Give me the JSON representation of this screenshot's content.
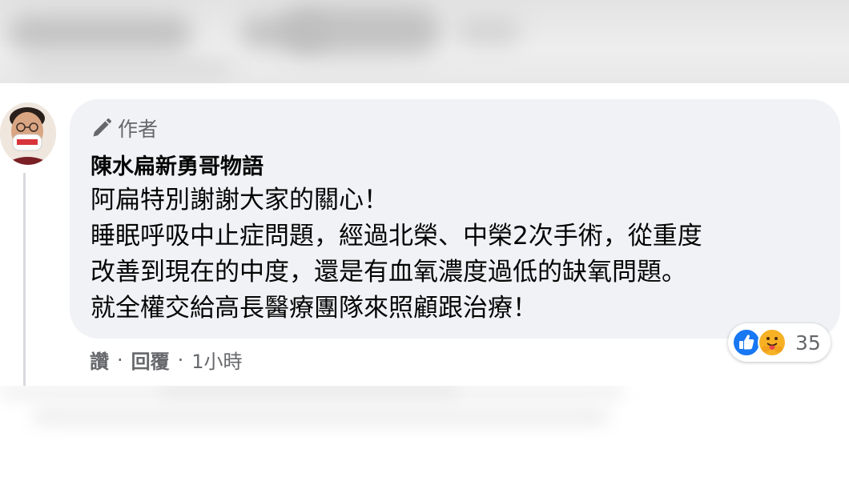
{
  "comment": {
    "author_badge": "作者",
    "author_name": "陳水扁新勇哥物語",
    "lines": [
      "阿扁特別謝謝大家的關心！",
      "睡眠呼吸中止症問題，經過北榮、中榮2次手術，從重度",
      "改善到現在的中度，還是有血氧濃度過低的缺氧問題。",
      "就全權交給高長醫療團隊來照顧跟治療！"
    ],
    "reaction_count": "35",
    "reactions": [
      "like-icon",
      "care-icon"
    ]
  },
  "actions": {
    "like_label": "讚",
    "separator": "·",
    "reply_label": "回覆",
    "time": "1小時"
  },
  "colors": {
    "bubble_bg": "#f0f2f5",
    "text": "#050505",
    "secondary_text": "#65676b",
    "like_blue": "#1877f2",
    "care_yellow": "#f7b125"
  }
}
